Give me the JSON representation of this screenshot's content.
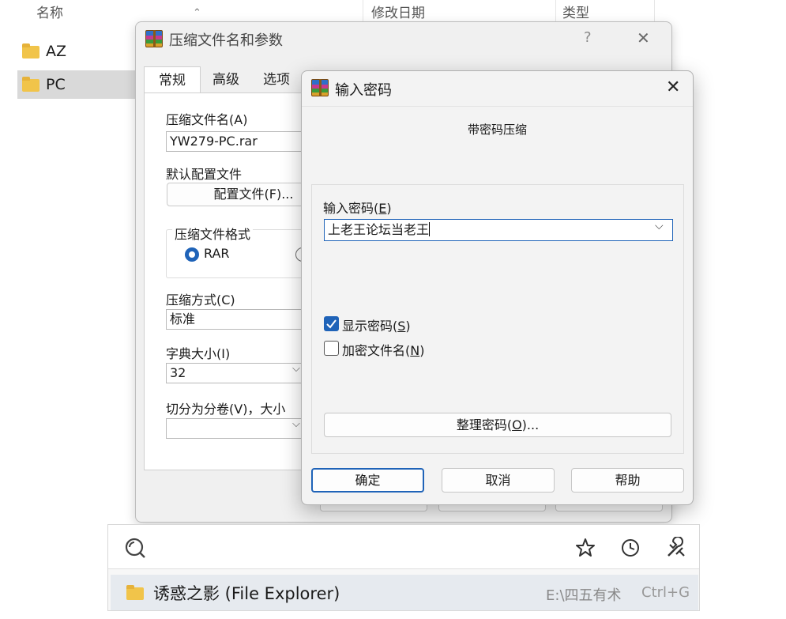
{
  "explorer": {
    "columns": {
      "name": "名称",
      "modified": "修改日期",
      "type": "类型"
    },
    "rows": [
      {
        "name": "AZ"
      },
      {
        "name": "PC"
      }
    ]
  },
  "archive_dialog": {
    "title": "压缩文件名和参数",
    "help_symbol": "?",
    "close_symbol": "✕",
    "tabs": [
      "常规",
      "高级",
      "选项"
    ],
    "archive_name_label": "压缩文件名(A)",
    "archive_name_value": "YW279-PC.rar",
    "default_profile_label": "默认配置文件",
    "profile_button": "配置文件(F)...",
    "format_group_label": "压缩文件格式",
    "format_rar": "RAR",
    "method_label": "压缩方式(C)",
    "method_value": "标准",
    "dict_label": "字典大小(I)",
    "dict_value": "32",
    "split_label": "切分为分卷(V)，大小"
  },
  "password_dialog": {
    "title": "输入密码",
    "close_symbol": "✕",
    "subtitle": "带密码压缩",
    "input_label": "输入密码(",
    "input_label_key": "E",
    "input_label_end": ")",
    "password_value": "上老王论坛当老王",
    "show_password_label": "显示密码(",
    "show_password_key": "S",
    "show_password_end": ")",
    "show_password_checked": true,
    "encrypt_names_label": "加密文件名(",
    "encrypt_names_key": "N",
    "encrypt_names_end": ")",
    "encrypt_names_checked": false,
    "organize_label": "整理密码(",
    "organize_key": "O",
    "organize_end": ")...",
    "ok_button": "确定",
    "cancel_button": "取消",
    "help_button": "帮助",
    "accent_color": "#1f63b8"
  },
  "launcher": {
    "result_title": "诱惑之影 (File Explorer)",
    "result_path": "E:\\四五有术",
    "result_shortcut": "Ctrl+G"
  }
}
